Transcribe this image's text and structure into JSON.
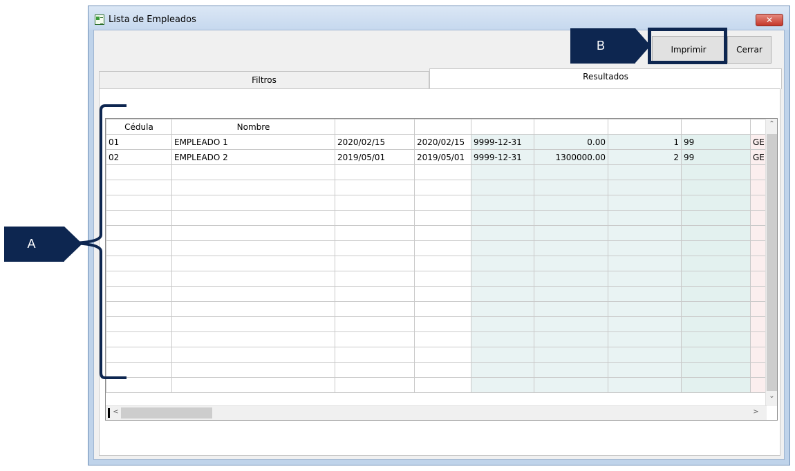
{
  "window": {
    "title": "Lista de Empleados",
    "close_glyph": "✕",
    "icon": "report-icon"
  },
  "toolbar": {
    "print_label": "Imprimir",
    "close_label": "Cerrar"
  },
  "tabs": [
    {
      "label": "Filtros",
      "selected": false
    },
    {
      "label": "Resultados",
      "selected": true
    }
  ],
  "grid": {
    "columns": [
      "Cédula",
      "Nombre",
      "",
      "",
      "",
      "",
      "",
      "",
      ""
    ],
    "rows": [
      [
        "01",
        "EMPLEADO 1",
        "2020/02/15",
        "2020/02/15",
        "9999-12-31",
        "0.00",
        "1",
        "99",
        "GE"
      ],
      [
        "02",
        "EMPLEADO 2",
        "2019/05/01",
        "2019/05/01",
        "9999-12-31",
        "1300000.00",
        "2",
        "99",
        "GE"
      ]
    ],
    "empty_rows": 15
  },
  "scrollbars": {
    "up": "⌃",
    "down": "⌄",
    "left": "<",
    "right": ">"
  },
  "annotations": {
    "a_label": "A",
    "b_label": "B",
    "color": "#0d2650"
  }
}
